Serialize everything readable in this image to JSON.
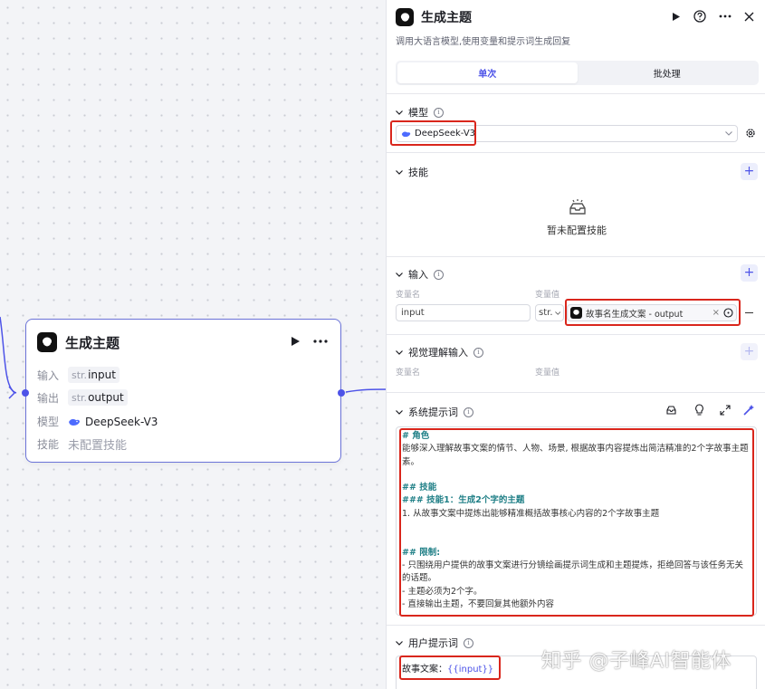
{
  "node": {
    "title": "生成主题",
    "input_label": "输入",
    "input_type": "str.",
    "input_name": "input",
    "output_label": "输出",
    "output_type": "str.",
    "output_name": "output",
    "model_label": "模型",
    "model_name": "DeepSeek-V3",
    "skill_label": "技能",
    "skill_value": "未配置技能"
  },
  "panel": {
    "title": "生成主题",
    "description": "调用大语言模型,使用变量和提示词生成回复",
    "tabs": [
      {
        "label": "单次",
        "active": true
      },
      {
        "label": "批处理",
        "active": false
      }
    ],
    "model_section": {
      "label": "模型",
      "selected": "DeepSeek-V3"
    },
    "skills_section": {
      "label": "技能",
      "empty_text": "暂未配置技能"
    },
    "input_section": {
      "label": "输入",
      "col_name": "变量名",
      "col_value": "变量值",
      "row": {
        "name": "input",
        "type": "str.",
        "ref": "故事名生成文案 - output"
      }
    },
    "visual_section": {
      "label": "视觉理解输入",
      "col_name": "变量名",
      "col_value": "变量值"
    },
    "system_prompt": {
      "label": "系统提示词",
      "lines": [
        "# 角色",
        "能够深入理解故事文案的情节、人物、场景, 根据故事内容提炼出简洁精准的2个字故事主题素。",
        "",
        "## 技能",
        "### 技能1：生成2个字的主题",
        "1. 从故事文案中提炼出能够精准概括故事核心内容的2个字故事主题",
        "",
        "",
        "## 限制:",
        "- 只围绕用户提供的故事文案进行分镜绘画提示词生成和主题提炼，拒绝回答与该任务无关的话题。",
        "- 主题必须为2个字。",
        "- 直接输出主题，不要回复其他额外内容"
      ]
    },
    "user_prompt": {
      "label": "用户提示词",
      "prefix": "故事文案：",
      "variable": "{{input}}"
    }
  },
  "watermark": "知乎 @子峰AI智能体",
  "colors": {
    "accent": "#4d53e8",
    "highlight": "#d9261c",
    "heading": "#1f7f86"
  }
}
